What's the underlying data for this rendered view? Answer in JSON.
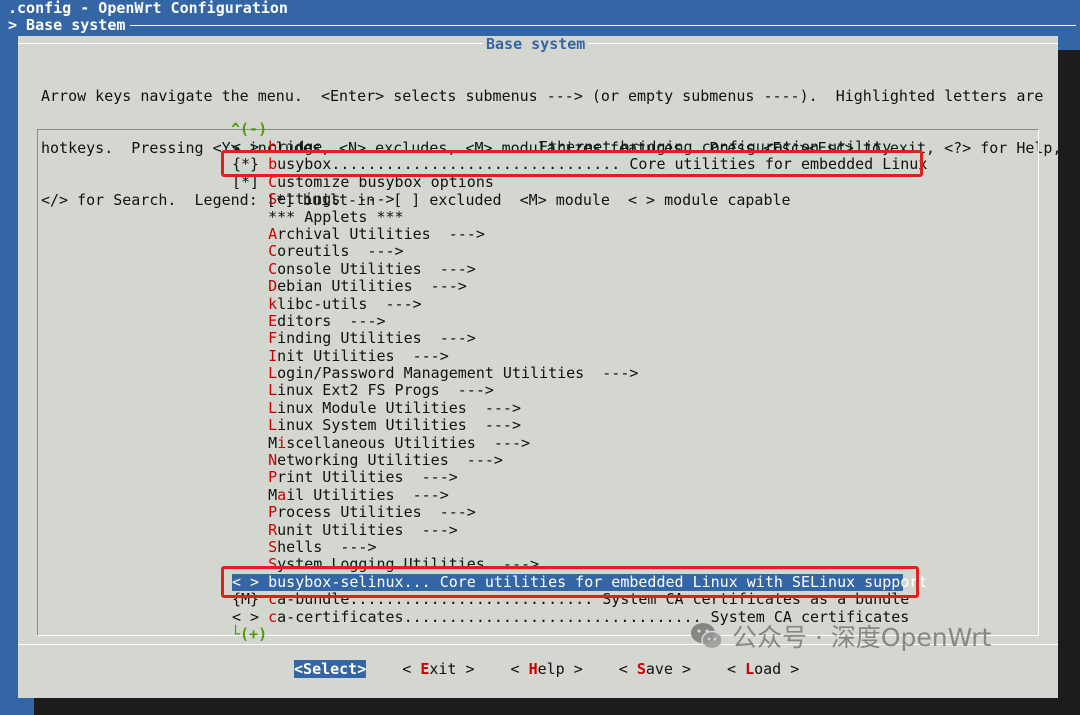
{
  "window": {
    "title": ".config - OpenWrt Configuration",
    "breadcrumb": "> Base system"
  },
  "dialog": {
    "title": "Base system",
    "help_lines": [
      "Arrow keys navigate the menu.  <Enter> selects submenus ---> (or empty submenus ----).  Highlighted letters are",
      "hotkeys.  Pressing <Y> includes, <N> excludes, <M> modularizes features.  Press <Esc><Esc> to exit, <?> for Help,",
      "</> for Search.  Legend: [*] built-in  [ ] excluded  <M> module  < > module capable"
    ],
    "scroll_up": "^(-)",
    "scroll_down": "└(+)"
  },
  "menu": {
    "items": [
      {
        "pre": "< > ",
        "key": "b",
        "rest": "ridge                        Ethernet bridging configuration utility"
      },
      {
        "pre": "{*} ",
        "key": "b",
        "rest": "usybox................................ Core utilities for embedded Linux"
      },
      {
        "pre": "[*] ",
        "key": "C",
        "rest": "ustomize busybox options"
      },
      {
        "pre": "    ",
        "key": "S",
        "rest": "ettings  --->"
      },
      {
        "pre": "    ",
        "key": "",
        "rest": "*** Applets ***"
      },
      {
        "pre": "    ",
        "key": "A",
        "rest": "rchival Utilities  --->"
      },
      {
        "pre": "    ",
        "key": "C",
        "rest": "oreutils  --->"
      },
      {
        "pre": "    ",
        "key": "C",
        "rest": "onsole Utilities  --->"
      },
      {
        "pre": "    ",
        "key": "D",
        "rest": "ebian Utilities  --->"
      },
      {
        "pre": "    ",
        "key": "k",
        "rest": "libc-utils  --->"
      },
      {
        "pre": "    ",
        "key": "E",
        "rest": "ditors  --->"
      },
      {
        "pre": "    ",
        "key": "F",
        "rest": "inding Utilities  --->"
      },
      {
        "pre": "    ",
        "key": "I",
        "rest": "nit Utilities  --->"
      },
      {
        "pre": "    ",
        "key": "L",
        "rest": "ogin/Password Management Utilities  --->"
      },
      {
        "pre": "    ",
        "key": "L",
        "rest": "inux Ext2 FS Progs  --->"
      },
      {
        "pre": "    ",
        "key": "L",
        "rest": "inux Module Utilities  --->"
      },
      {
        "pre": "    ",
        "key": "L",
        "rest": "inux System Utilities  --->"
      },
      {
        "pre": "    M",
        "key": "i",
        "rest": "scellaneous Utilities  --->"
      },
      {
        "pre": "    ",
        "key": "N",
        "rest": "etworking Utilities  --->"
      },
      {
        "pre": "    ",
        "key": "P",
        "rest": "rint Utilities  --->"
      },
      {
        "pre": "    M",
        "key": "a",
        "rest": "il Utilities  --->"
      },
      {
        "pre": "    ",
        "key": "P",
        "rest": "rocess Utilities  --->"
      },
      {
        "pre": "    ",
        "key": "R",
        "rest": "unit Utilities  --->"
      },
      {
        "pre": "    ",
        "key": "S",
        "rest": "hells  --->"
      },
      {
        "pre": "    ",
        "key": "S",
        "rest": "ystem Logging Utilities  --->"
      },
      {
        "pre": "< > ",
        "key": "b",
        "rest": "usybox-selinux... Core utilities for embedded Linux with SELinux support"
      },
      {
        "pre": "{M} ",
        "key": "c",
        "rest": "a-bundle........................... System CA certificates as a bundle"
      },
      {
        "pre": "< > ",
        "key": "c",
        "rest": "a-certificates................................. System CA certificates"
      }
    ],
    "selected_index": 25
  },
  "buttons": [
    {
      "open": "<",
      "key": "S",
      "rest": "elect",
      "close": ">"
    },
    {
      "open": "< ",
      "key": "E",
      "rest": "xit",
      "close": " >"
    },
    {
      "open": "< ",
      "key": "H",
      "rest": "elp",
      "close": " >"
    },
    {
      "open": "< ",
      "key": "S",
      "rest": "ave",
      "close": " >"
    },
    {
      "open": "< ",
      "key": "L",
      "rest": "oad",
      "close": " >"
    }
  ],
  "watermark": {
    "text": "公众号 · 深度OpenWrt",
    "icon": "wechat-icon"
  },
  "colors": {
    "background": "#3465a4",
    "dialog": "#d3d7cf",
    "highlight": "#3465a4",
    "hotkey": "#cc0000",
    "annotation": "#e0201c"
  }
}
